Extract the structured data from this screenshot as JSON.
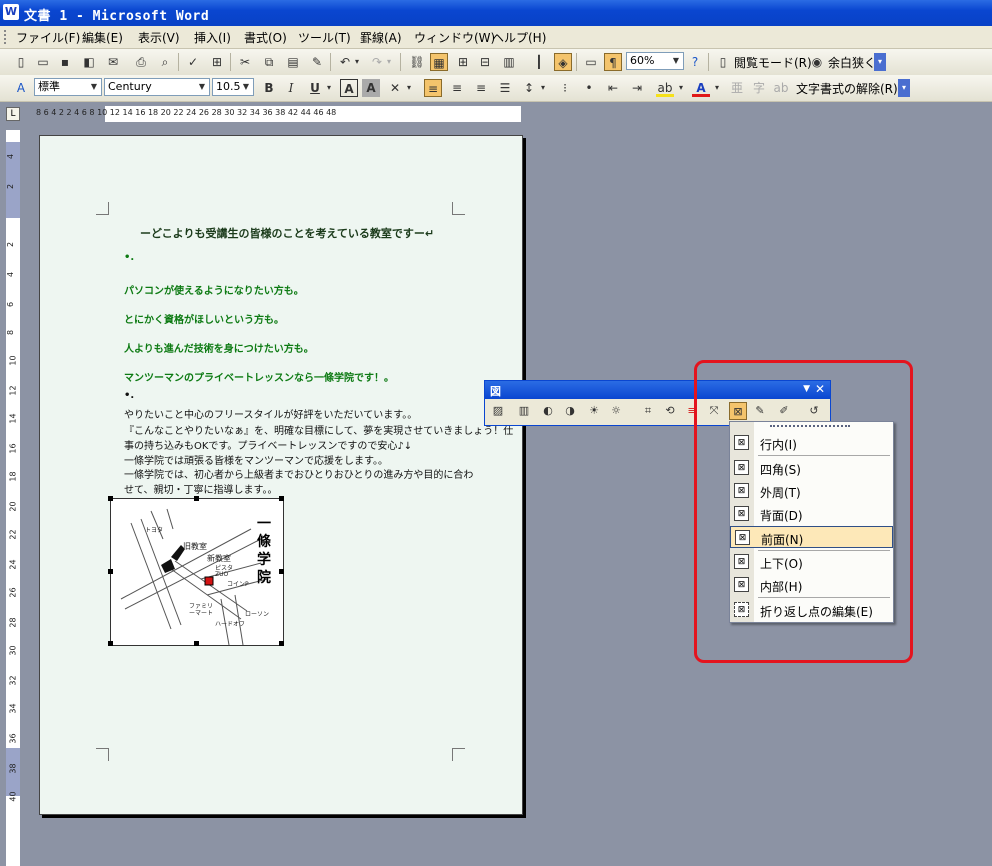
{
  "window": {
    "title": "文書 1 - Microsoft Word",
    "app_icon": "W"
  },
  "menubar": {
    "items": [
      "ファイル(F)",
      "編集(E)",
      "表示(V)",
      "挿入(I)",
      "書式(O)",
      "ツール(T)",
      "罫線(A)",
      "ウィンドウ(W)",
      "ヘルプ(H)"
    ]
  },
  "standard_toolbar": {
    "zoom": "60%",
    "reading_mode": "閲覧モード(R)",
    "margin_narrow": "余白狭く"
  },
  "format_toolbar": {
    "style": "標準",
    "font": "Century",
    "size": "10.5",
    "clear_format": "文字書式の解除(R)"
  },
  "ruler": {
    "marks": "8 6 4 2 2 4 6 8 10 12 14 16 18 20 22 24 26 28 30 32 34 36 38 42 44 46 48",
    "vertical": [
      "4",
      "2",
      "2",
      "4",
      "6",
      "8",
      "10",
      "12",
      "14",
      "16",
      "18",
      "20",
      "22",
      "24",
      "26",
      "28",
      "30",
      "32",
      "34",
      "36",
      "38",
      "40"
    ]
  },
  "document": {
    "heading": "ーどこよりも受講生の皆様のことを考えている教室ですー↵",
    "lines": [
      "パソコンが使えるようになりたい方も。",
      "とにかく資格がほしいという方も。",
      "人よりも進んだ技術を身につけたい方も。",
      "マンツーマンのプライベートレッスンなら一條学院です！。"
    ],
    "body": [
      "やりたいこと中心のフリースタイルが好評をいただいています。。",
      "『こんなことやりたいなぁ』を、明確な目標にして、夢を実現させていきましょう！仕",
      "事の持ち込みもOKです。プライベートレッスンですので安心♪↓",
      "一條学院では頑張る皆様をマンツーマンで応援をします。。",
      "一條学院では、初心者から上級者までおひとりおひとりの進み方や目的に合わ",
      "せて、親切・丁寧に指導します。。"
    ],
    "map": {
      "school_name": "一條学院",
      "labels": [
        "旧教室",
        "新教室",
        "ピスタ",
        "ZUO",
        "コインP",
        "ローソン",
        "ハードオフ",
        "ファミリーマート",
        "トヨタ"
      ]
    }
  },
  "picture_toolbar": {
    "title": "図"
  },
  "wrap_menu": {
    "items": [
      "行内(I)",
      "四角(S)",
      "外周(T)",
      "背面(D)",
      "前面(N)",
      "上下(O)",
      "内部(H)",
      "折り返し点の編集(E)"
    ],
    "highlighted": "前面(N)"
  },
  "colors": {
    "accent_red": "#e4141e",
    "title_blue": "#0a46d0",
    "menu_highlight": "#fde8b8",
    "doc_green": "#0c7a12"
  }
}
